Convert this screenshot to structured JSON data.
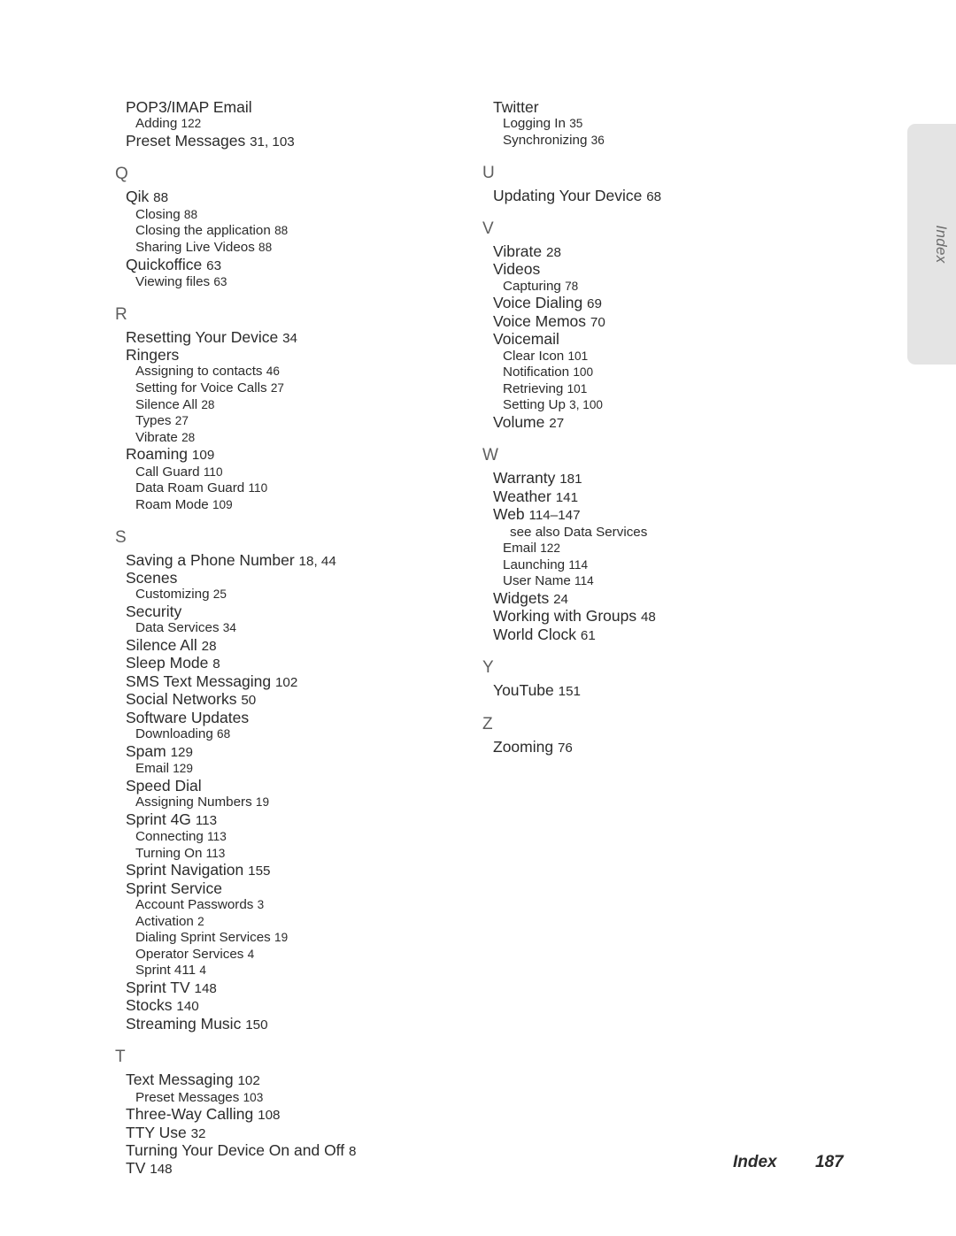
{
  "side_tab": {
    "label": "Index"
  },
  "footer": {
    "label": "Index",
    "page_number": "187"
  },
  "index": {
    "columns": [
      {
        "name": "left",
        "blocks": [
          {
            "letter": "",
            "entries": [
              {
                "level": 1,
                "text": "POP3/IMAP Email",
                "pages": ""
              },
              {
                "level": 2,
                "text": "Adding",
                "pages": "122"
              },
              {
                "level": 1,
                "text": "Preset Messages",
                "pages": "31, 103"
              }
            ]
          },
          {
            "letter": "Q",
            "entries": [
              {
                "level": 1,
                "text": "Qik",
                "pages": "88"
              },
              {
                "level": 2,
                "text": "Closing",
                "pages": "88"
              },
              {
                "level": 2,
                "text": "Closing the application",
                "pages": "88"
              },
              {
                "level": 2,
                "text": "Sharing Live Videos",
                "pages": "88"
              },
              {
                "level": 1,
                "text": "Quickoffice",
                "pages": "63"
              },
              {
                "level": 2,
                "text": "Viewing files",
                "pages": "63"
              }
            ]
          },
          {
            "letter": "R",
            "entries": [
              {
                "level": 1,
                "text": "Resetting Your Device",
                "pages": "34"
              },
              {
                "level": 1,
                "text": "Ringers",
                "pages": ""
              },
              {
                "level": 2,
                "text": "Assigning to contacts",
                "pages": "46"
              },
              {
                "level": 2,
                "text": "Setting for Voice Calls",
                "pages": "27"
              },
              {
                "level": 2,
                "text": "Silence All",
                "pages": "28"
              },
              {
                "level": 2,
                "text": "Types",
                "pages": "27"
              },
              {
                "level": 2,
                "text": "Vibrate",
                "pages": "28"
              },
              {
                "level": 1,
                "text": "Roaming",
                "pages": "109"
              },
              {
                "level": 2,
                "text": "Call Guard",
                "pages": "110"
              },
              {
                "level": 2,
                "text": "Data Roam Guard",
                "pages": "110"
              },
              {
                "level": 2,
                "text": "Roam Mode",
                "pages": "109"
              }
            ]
          },
          {
            "letter": "S",
            "entries": [
              {
                "level": 1,
                "text": "Saving a Phone Number",
                "pages": "18, 44"
              },
              {
                "level": 1,
                "text": "Scenes",
                "pages": ""
              },
              {
                "level": 2,
                "text": "Customizing",
                "pages": "25"
              },
              {
                "level": 1,
                "text": "Security",
                "pages": ""
              },
              {
                "level": 2,
                "text": "Data Services",
                "pages": "34"
              },
              {
                "level": 1,
                "text": "Silence All",
                "pages": "28"
              },
              {
                "level": 1,
                "text": "Sleep Mode",
                "pages": "8"
              },
              {
                "level": 1,
                "text": "SMS Text Messaging",
                "pages": "102"
              },
              {
                "level": 1,
                "text": "Social Networks",
                "pages": "50"
              },
              {
                "level": 1,
                "text": "Software Updates",
                "pages": ""
              },
              {
                "level": 2,
                "text": "Downloading",
                "pages": "68"
              },
              {
                "level": 1,
                "text": "Spam",
                "pages": "129"
              },
              {
                "level": 2,
                "text": "Email",
                "pages": "129"
              },
              {
                "level": 1,
                "text": "Speed Dial",
                "pages": ""
              },
              {
                "level": 2,
                "text": "Assigning Numbers",
                "pages": "19"
              },
              {
                "level": 1,
                "text": "Sprint 4G",
                "pages": "113"
              },
              {
                "level": 2,
                "text": "Connecting",
                "pages": "113"
              },
              {
                "level": 2,
                "text": "Turning On",
                "pages": "113"
              },
              {
                "level": 1,
                "text": "Sprint Navigation",
                "pages": "155"
              },
              {
                "level": 1,
                "text": "Sprint Service",
                "pages": ""
              },
              {
                "level": 2,
                "text": "Account Passwords",
                "pages": "3"
              },
              {
                "level": 2,
                "text": "Activation",
                "pages": "2"
              },
              {
                "level": 2,
                "text": "Dialing Sprint Services",
                "pages": "19"
              },
              {
                "level": 2,
                "text": "Operator Services",
                "pages": "4"
              },
              {
                "level": 2,
                "text": "Sprint 411",
                "pages": "4"
              },
              {
                "level": 1,
                "text": "Sprint TV",
                "pages": "148"
              },
              {
                "level": 1,
                "text": "Stocks",
                "pages": "140"
              },
              {
                "level": 1,
                "text": "Streaming Music",
                "pages": "150"
              }
            ]
          },
          {
            "letter": "T",
            "entries": [
              {
                "level": 1,
                "text": "Text Messaging",
                "pages": "102"
              },
              {
                "level": 2,
                "text": "Preset Messages",
                "pages": "103"
              },
              {
                "level": 1,
                "text": "Three-Way Calling",
                "pages": "108"
              },
              {
                "level": 1,
                "text": "TTY Use",
                "pages": "32"
              },
              {
                "level": 1,
                "text": "Turning Your Device On and Off",
                "pages": "8"
              },
              {
                "level": 1,
                "text": "TV",
                "pages": "148"
              }
            ]
          }
        ]
      },
      {
        "name": "right",
        "blocks": [
          {
            "letter": "",
            "entries": [
              {
                "level": 1,
                "text": "Twitter",
                "pages": ""
              },
              {
                "level": 2,
                "text": "Logging In",
                "pages": "35"
              },
              {
                "level": 2,
                "text": "Synchronizing",
                "pages": "36"
              }
            ]
          },
          {
            "letter": "U",
            "entries": [
              {
                "level": 1,
                "text": "Updating Your Device",
                "pages": "68"
              }
            ]
          },
          {
            "letter": "V",
            "entries": [
              {
                "level": 1,
                "text": "Vibrate",
                "pages": "28"
              },
              {
                "level": 1,
                "text": "Videos",
                "pages": ""
              },
              {
                "level": 2,
                "text": "Capturing",
                "pages": "78"
              },
              {
                "level": 1,
                "text": "Voice Dialing",
                "pages": "69"
              },
              {
                "level": 1,
                "text": "Voice Memos",
                "pages": "70"
              },
              {
                "level": 1,
                "text": "Voicemail",
                "pages": ""
              },
              {
                "level": 2,
                "text": "Clear Icon",
                "pages": "101"
              },
              {
                "level": 2,
                "text": "Notification",
                "pages": "100"
              },
              {
                "level": 2,
                "text": "Retrieving",
                "pages": "101"
              },
              {
                "level": 2,
                "text": "Setting Up",
                "pages": "3, 100"
              },
              {
                "level": 1,
                "text": "Volume",
                "pages": "27"
              }
            ]
          },
          {
            "letter": "W",
            "entries": [
              {
                "level": 1,
                "text": "Warranty",
                "pages": "181"
              },
              {
                "level": 1,
                "text": "Weather",
                "pages": "141"
              },
              {
                "level": 1,
                "text": "Web",
                "pages": "114–147"
              },
              {
                "level": 3,
                "text": "see also Data Services",
                "pages": ""
              },
              {
                "level": 2,
                "text": "Email",
                "pages": "122"
              },
              {
                "level": 2,
                "text": "Launching",
                "pages": "114"
              },
              {
                "level": 2,
                "text": "User Name",
                "pages": "114"
              },
              {
                "level": 1,
                "text": "Widgets",
                "pages": "24"
              },
              {
                "level": 1,
                "text": "Working with Groups",
                "pages": "48"
              },
              {
                "level": 1,
                "text": "World Clock",
                "pages": "61"
              }
            ]
          },
          {
            "letter": "Y",
            "entries": [
              {
                "level": 1,
                "text": "YouTube",
                "pages": "151"
              }
            ]
          },
          {
            "letter": "Z",
            "entries": [
              {
                "level": 1,
                "text": "Zooming",
                "pages": "76"
              }
            ]
          }
        ]
      }
    ]
  }
}
